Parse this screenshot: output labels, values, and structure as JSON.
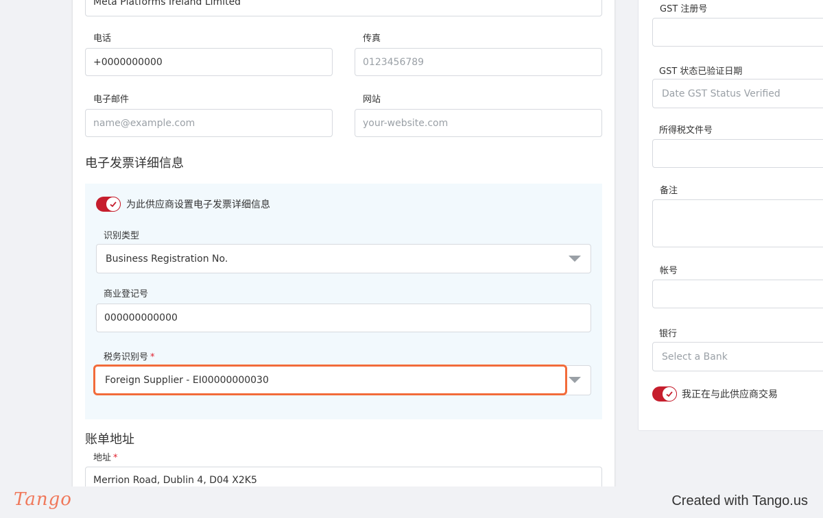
{
  "main": {
    "company_name_value": "Meta Platforms Ireland Limited",
    "phone": {
      "label": "电话",
      "value": "+0000000000"
    },
    "fax": {
      "label": "传真",
      "placeholder": "0123456789"
    },
    "email": {
      "label": "电子邮件",
      "placeholder": "name@example.com"
    },
    "website": {
      "label": "网站",
      "placeholder": "your-website.com"
    },
    "einvoice_section_title": "电子发票详细信息",
    "einvoice": {
      "toggle_label": "为此供应商设置电子发票详细信息",
      "toggle_on": true,
      "id_type": {
        "label": "识别类型",
        "value": "Business Registration No."
      },
      "brn": {
        "label": "商业登记号",
        "value": "000000000000"
      },
      "tin": {
        "label": "税务识别号",
        "required_mark": "*",
        "value": "Foreign Supplier - EI00000000030"
      }
    },
    "billing_section_title": "账单地址",
    "address": {
      "label": "地址",
      "required_mark": "*",
      "value": "Merrion Road, Dublin 4, D04 X2K5"
    }
  },
  "side": {
    "gst_reg": {
      "label": "GST 注册号",
      "value": ""
    },
    "gst_date": {
      "label": "GST 状态已验证日期",
      "placeholder": "Date GST Status Verified"
    },
    "income_tax": {
      "label": "所得税文件号",
      "value": ""
    },
    "notes": {
      "label": "备注",
      "value": ""
    },
    "account": {
      "label": "帐号",
      "value": ""
    },
    "bank": {
      "label": "银行",
      "placeholder": "Select a Bank"
    },
    "trading_toggle_label": "我正在与此供应商交易",
    "trading_toggle_on": true
  },
  "footer": {
    "logo_text": "Tango",
    "credit_text": "Created with Tango.us"
  },
  "colors": {
    "toggle_on": "#c61e2d",
    "highlight": "#f26b3a",
    "panel_bg": "#f2f9fd",
    "logo": "#f0785a"
  }
}
